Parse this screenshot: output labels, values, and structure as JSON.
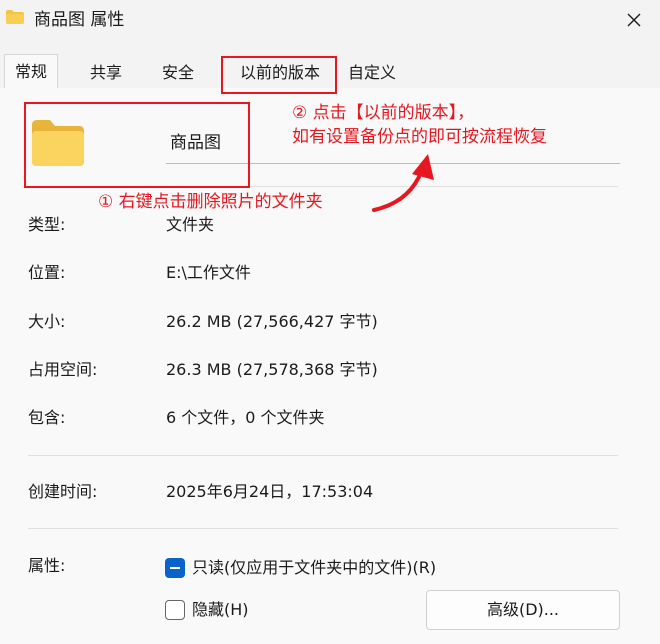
{
  "window": {
    "title": "商品图 属性",
    "close_icon": "close-icon"
  },
  "tabs": [
    {
      "label": "常规",
      "active": true
    },
    {
      "label": "共享",
      "active": false
    },
    {
      "label": "安全",
      "active": false
    },
    {
      "label": "以前的版本",
      "active": false
    },
    {
      "label": "自定义",
      "active": false
    }
  ],
  "general": {
    "folder_icon": "folder-icon",
    "name_value": "商品图",
    "rows": [
      {
        "label": "类型:",
        "value": "文件夹"
      },
      {
        "label": "位置:",
        "value": "E:\\工作文件"
      },
      {
        "label": "大小:",
        "value": "26.2 MB (27,566,427 字节)"
      },
      {
        "label": "占用空间:",
        "value": "26.3 MB (27,578,368 字节)"
      },
      {
        "label": "包含:",
        "value": "6 个文件，0 个文件夹"
      },
      {
        "label": "创建时间:",
        "value": "2025年6月24日，17:53:04"
      }
    ],
    "attributes": {
      "label": "属性:",
      "readonly_label": "只读(仅应用于文件夹中的文件)(R)",
      "readonly_state": "indeterminate",
      "hidden_label": "隐藏(H)",
      "hidden_checked": false,
      "advanced_button": "高级(D)..."
    }
  },
  "annotations": {
    "note1": "① 右键点击删除照片的文件夹",
    "note2_line1": "② 点击【以前的版本】，",
    "note2_line2": "如有设置备份点的即可按流程恢复",
    "color": "#e8161f"
  }
}
